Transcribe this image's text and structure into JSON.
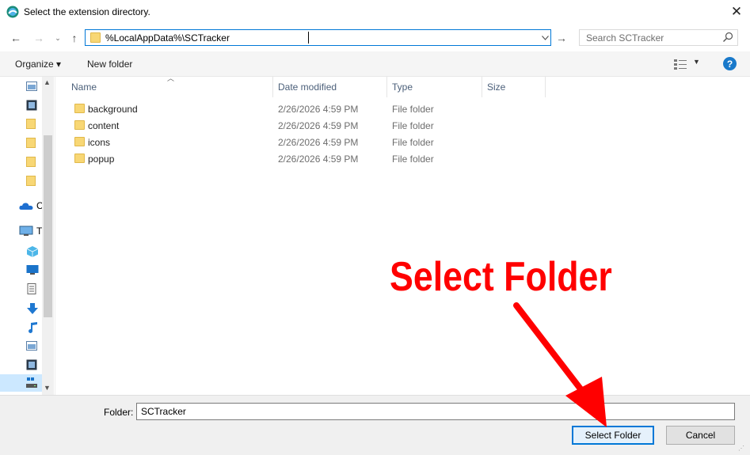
{
  "window": {
    "title": "Select the extension directory.",
    "close_glyph": "✕"
  },
  "nav": {
    "back_glyph": "←",
    "forward_glyph": "→",
    "recent_glyph": "⌄",
    "up_glyph": "↑",
    "address": "%LocalAppData%\\SCTracker",
    "go_glyph": "→",
    "search_placeholder": "Search SCTracker"
  },
  "toolbar": {
    "organize": "Organize ▾",
    "new_folder": "New folder",
    "help_glyph": "?"
  },
  "sidebar_icons": [
    "pictures-icon",
    "videos-icon",
    "folder-icon",
    "folder-icon",
    "folder-icon",
    "folder-icon",
    "onedrive-icon",
    "this-pc-icon",
    "3d-objects-icon",
    "desktop-icon",
    "documents-icon",
    "downloads-icon",
    "music-icon",
    "pictures-icon",
    "videos-icon",
    "local-disk-icon"
  ],
  "sidebar_labels": {
    "onedrive": "C",
    "this_pc": "T"
  },
  "columns": {
    "name": "Name",
    "date": "Date modified",
    "type": "Type",
    "size": "Size"
  },
  "files": [
    {
      "name": "background",
      "date": "2/26/2026 4:59 PM",
      "type": "File folder"
    },
    {
      "name": "content",
      "date": "2/26/2026 4:59 PM",
      "type": "File folder"
    },
    {
      "name": "icons",
      "date": "2/26/2026 4:59 PM",
      "type": "File folder"
    },
    {
      "name": "popup",
      "date": "2/26/2026 4:59 PM",
      "type": "File folder"
    }
  ],
  "footer": {
    "folder_label": "Folder:",
    "folder_value": "SCTracker",
    "select_button": "Select Folder",
    "cancel_button": "Cancel"
  },
  "annotation": {
    "text": "Select Folder",
    "color": "#ff0000"
  },
  "colors": {
    "accent": "#0078d7",
    "folder": "#f8d775",
    "help": "#1979ca"
  }
}
